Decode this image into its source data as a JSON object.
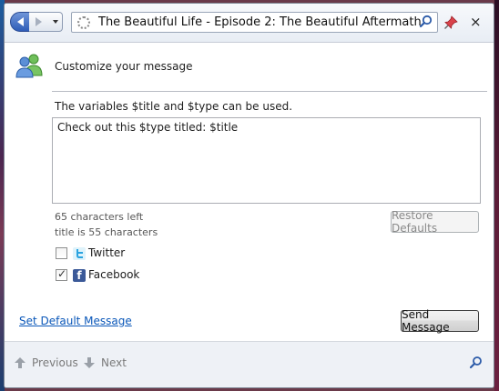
{
  "toolbar": {
    "url_title": "The Beautiful Life - Episode 2: The Beautiful Aftermath",
    "close_glyph": "×"
  },
  "header": {
    "title": "Customize your message"
  },
  "main": {
    "variables_hint": "The variables $title and $type can be used.",
    "message": "Check out this $type titled: $title",
    "chars_left": "65 characters left",
    "title_length": "title is 55 characters",
    "restore_defaults_label": "Restore Defaults",
    "services": [
      {
        "label": "Twitter",
        "checked": false
      },
      {
        "label": "Facebook",
        "checked": true
      }
    ],
    "set_default_link": "Set Default Message",
    "send_label": "Send Message"
  },
  "footer": {
    "previous_label": "Previous",
    "next_label": "Next"
  },
  "colors": {
    "accent_blue": "#2f5db8",
    "link": "#0a57b9",
    "facebook": "#3b5998",
    "twitter": "#2aa3e0"
  },
  "icons": [
    "back-icon",
    "forward-icon",
    "dropdown-icon",
    "loading-icon",
    "search-icon",
    "pin-icon",
    "close-icon",
    "share-people-icon",
    "twitter-icon",
    "facebook-icon",
    "arrow-up-icon",
    "arrow-down-icon"
  ]
}
